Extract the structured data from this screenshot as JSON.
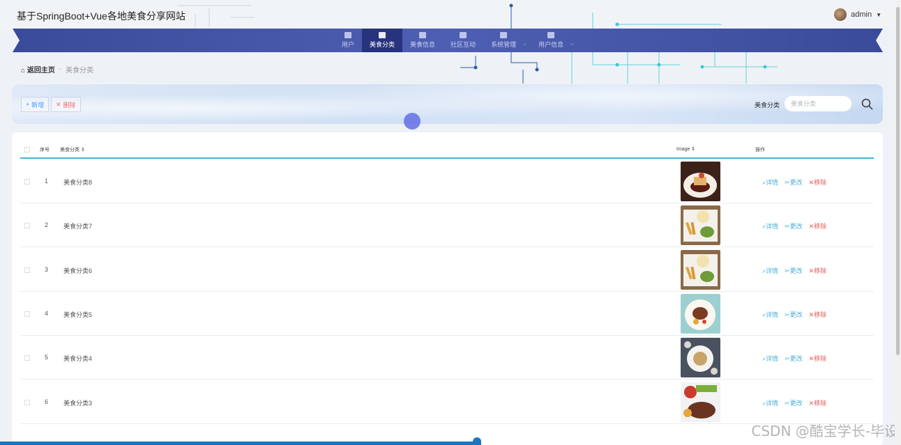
{
  "header": {
    "site_title": "基于SpringBoot+Vue各地美食分享网站",
    "user_name": "admin"
  },
  "nav": {
    "items": [
      {
        "label": "用户",
        "icon": "monitor-icon",
        "active": false,
        "dropdown": false
      },
      {
        "label": "美食分类",
        "icon": "chair-icon",
        "active": true,
        "dropdown": false
      },
      {
        "label": "美食信息",
        "icon": "clipboard-icon",
        "active": false,
        "dropdown": false
      },
      {
        "label": "社区互动",
        "icon": "chat-icon",
        "active": false,
        "dropdown": false
      },
      {
        "label": "系统管理",
        "icon": "grid-icon",
        "active": false,
        "dropdown": true
      },
      {
        "label": "用户信息",
        "icon": "window-icon",
        "active": false,
        "dropdown": true
      }
    ]
  },
  "breadcrumb": {
    "home": "返回主页",
    "separator": "-",
    "current": "美食分类"
  },
  "toolbar": {
    "add_label": "新增",
    "delete_label": "删除",
    "search_label": "美食分类",
    "search_placeholder": "美食分类"
  },
  "table": {
    "headers": {
      "index": "序号",
      "name": "美食分类",
      "image": "Image",
      "ops": "操作"
    },
    "ops": {
      "detail": "详情",
      "edit": "更改",
      "delete": "移除"
    },
    "rows": [
      {
        "index": "1",
        "name": "美食分类8",
        "image": "food-photo-dessert"
      },
      {
        "index": "2",
        "name": "美食分类7",
        "image": "food-photo-fries"
      },
      {
        "index": "3",
        "name": "美食分类6",
        "image": "food-photo-fries"
      },
      {
        "index": "4",
        "name": "美食分类5",
        "image": "food-photo-steak-plate"
      },
      {
        "index": "5",
        "name": "美食分类4",
        "image": "food-photo-pasta"
      },
      {
        "index": "6",
        "name": "美食分类3",
        "image": "food-photo-steak"
      }
    ]
  },
  "watermark": "CSDN @酷宝学长-毕设",
  "colors": {
    "nav_bg": "#3a4b9a",
    "nav_active": "#27337d",
    "accent_line": "#3fb4d6",
    "delete_red": "#e05d5d",
    "link_blue": "#4ab0d6"
  }
}
